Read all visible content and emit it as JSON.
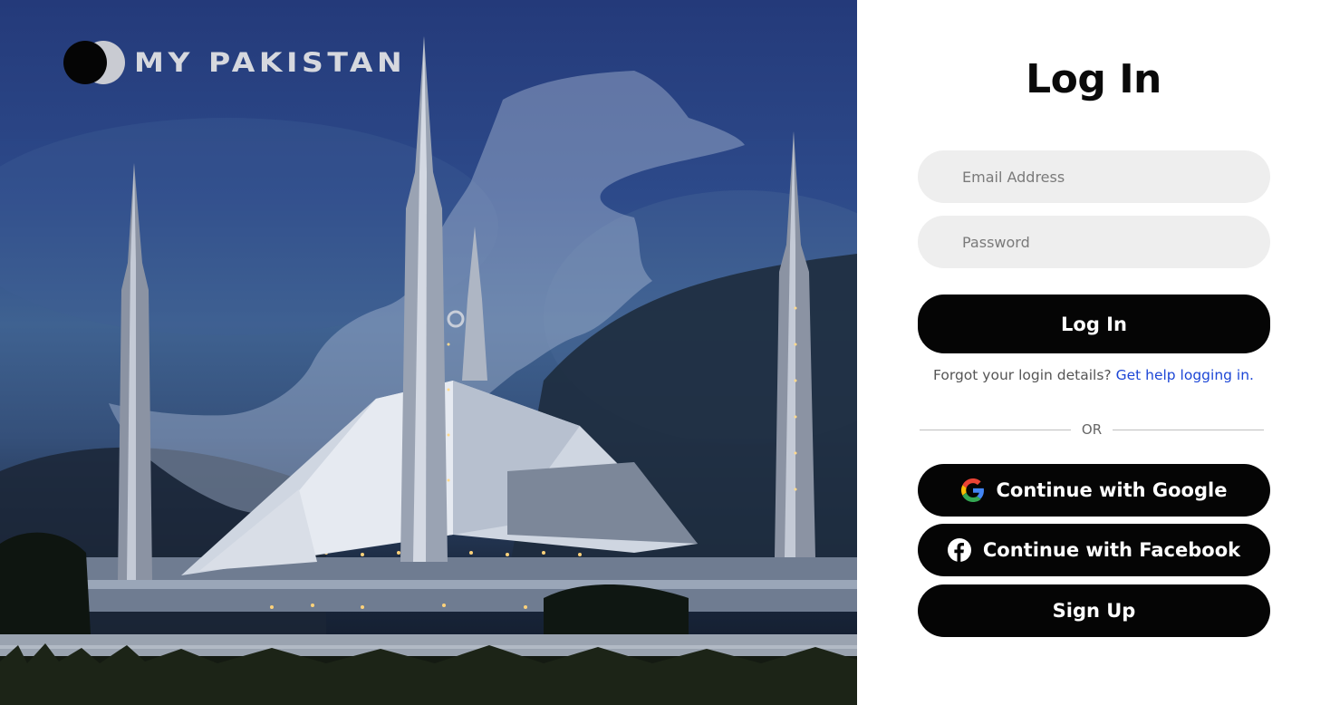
{
  "brand": {
    "name": "MY PAKISTAN"
  },
  "login": {
    "title": "Log In",
    "email_placeholder": "Email Address",
    "password_placeholder": "Password",
    "submit_label": "Log In",
    "help_text": "Forgot your login details?",
    "help_link": "Get help logging in.",
    "divider_text": "OR",
    "google_label": "Continue with Google",
    "facebook_label": "Continue with Facebook",
    "signup_label": "Sign Up"
  },
  "icons": {
    "google": "google-logo-icon",
    "facebook": "facebook-logo-icon",
    "brand": "brand-logo-icon"
  },
  "colors": {
    "button_bg": "#050505",
    "field_bg": "#eeeeee",
    "link": "#1d47d6",
    "panel_bg": "#ffffff"
  }
}
